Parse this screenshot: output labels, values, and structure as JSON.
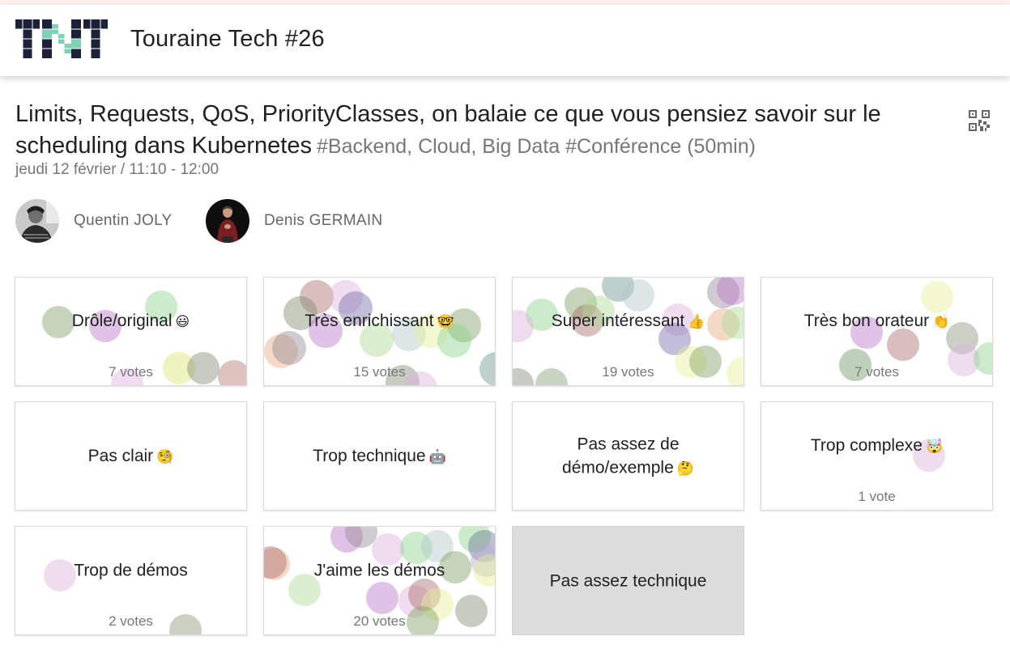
{
  "header": {
    "event_title": "Touraine Tech #26"
  },
  "talk": {
    "title": "Limits, Requests, QoS, PriorityClasses, on balaie ce que vous pensiez savoir sur le scheduling dans Kubernetes",
    "tags": "#Backend, Cloud, Big Data #Conférence (50min)",
    "date": "jeudi 12 février / 11:10 - 12:00",
    "speakers": [
      {
        "name": "Quentin JOLY"
      },
      {
        "name": "Denis GERMAIN"
      }
    ]
  },
  "feedback": [
    {
      "label": "Drôle/original",
      "emoji": "😃",
      "votes": "7 votes",
      "disabled": false
    },
    {
      "label": "Très enrichissant",
      "emoji": "🤓",
      "votes": "15 votes",
      "disabled": false
    },
    {
      "label": "Super intéressant",
      "emoji": "👍",
      "votes": "19 votes",
      "disabled": false
    },
    {
      "label": "Très bon orateur",
      "emoji": "👏",
      "votes": "7 votes",
      "disabled": false
    },
    {
      "label": "Pas clair",
      "emoji": "🧐",
      "votes": "",
      "disabled": false
    },
    {
      "label": "Trop technique",
      "emoji": "🤖",
      "votes": "",
      "disabled": false
    },
    {
      "label": "Pas assez de démo/exemple",
      "emoji": "🤔",
      "votes": "",
      "disabled": false
    },
    {
      "label": "Trop complexe",
      "emoji": "🤯",
      "votes": "1 vote",
      "disabled": false
    },
    {
      "label": "Trop de démos",
      "emoji": "",
      "votes": "2 votes",
      "disabled": false
    },
    {
      "label": "J'aime les démos",
      "emoji": "",
      "votes": "20 votes",
      "disabled": false
    },
    {
      "label": "Pas assez technique",
      "emoji": "",
      "votes": "",
      "disabled": true
    }
  ],
  "icons": {
    "logo": "touraine-tech-logo",
    "qr": "qr-code-icon"
  },
  "colors": {
    "logo_dark": "#1e2238",
    "logo_accent": "#7fd1b5",
    "disabled_card": "#dcdcdc"
  }
}
